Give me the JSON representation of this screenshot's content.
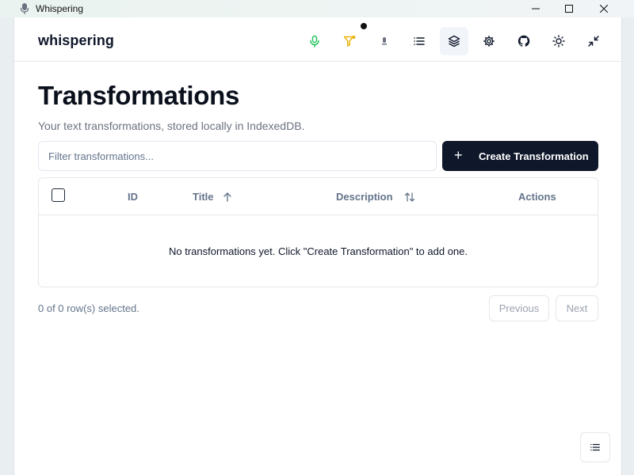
{
  "window": {
    "title": "Whispering",
    "minimize_glyph": "—",
    "maximize_glyph": "☐",
    "close_glyph": "✕"
  },
  "header": {
    "brand": "whispering",
    "nav": [
      {
        "name": "microphone-icon",
        "color": "#22c55e"
      },
      {
        "name": "filter-icon",
        "color": "#eab308"
      },
      {
        "name": "mic-icon",
        "color": "#6b7280"
      },
      {
        "name": "list-icon",
        "color": "#0f172a"
      },
      {
        "name": "layers-icon",
        "color": "#0f172a",
        "active": true
      },
      {
        "name": "gear-icon",
        "color": "#0f172a"
      },
      {
        "name": "github-icon",
        "color": "#0f172a"
      },
      {
        "name": "sun-icon",
        "color": "#0f172a"
      },
      {
        "name": "minimize-arrows-icon",
        "color": "#0f172a"
      }
    ]
  },
  "page": {
    "title": "Transformations",
    "subtitle": "Your text transformations, stored locally in IndexedDB."
  },
  "filter": {
    "placeholder": "Filter transformations...",
    "value": ""
  },
  "create_button": {
    "icon": "+",
    "label": "Create Transformation"
  },
  "table": {
    "columns": {
      "id": "ID",
      "title": "Title",
      "description": "Description",
      "actions": "Actions"
    },
    "rows": [],
    "empty_message": "No transformations yet. Click \"Create Transformation\" to add one."
  },
  "footer": {
    "selection": "0 of 0 row(s) selected.",
    "previous": "Previous",
    "next": "Next"
  },
  "colors": {
    "primary": "#0f172a",
    "muted": "#64748b",
    "border": "#e5e7eb"
  }
}
